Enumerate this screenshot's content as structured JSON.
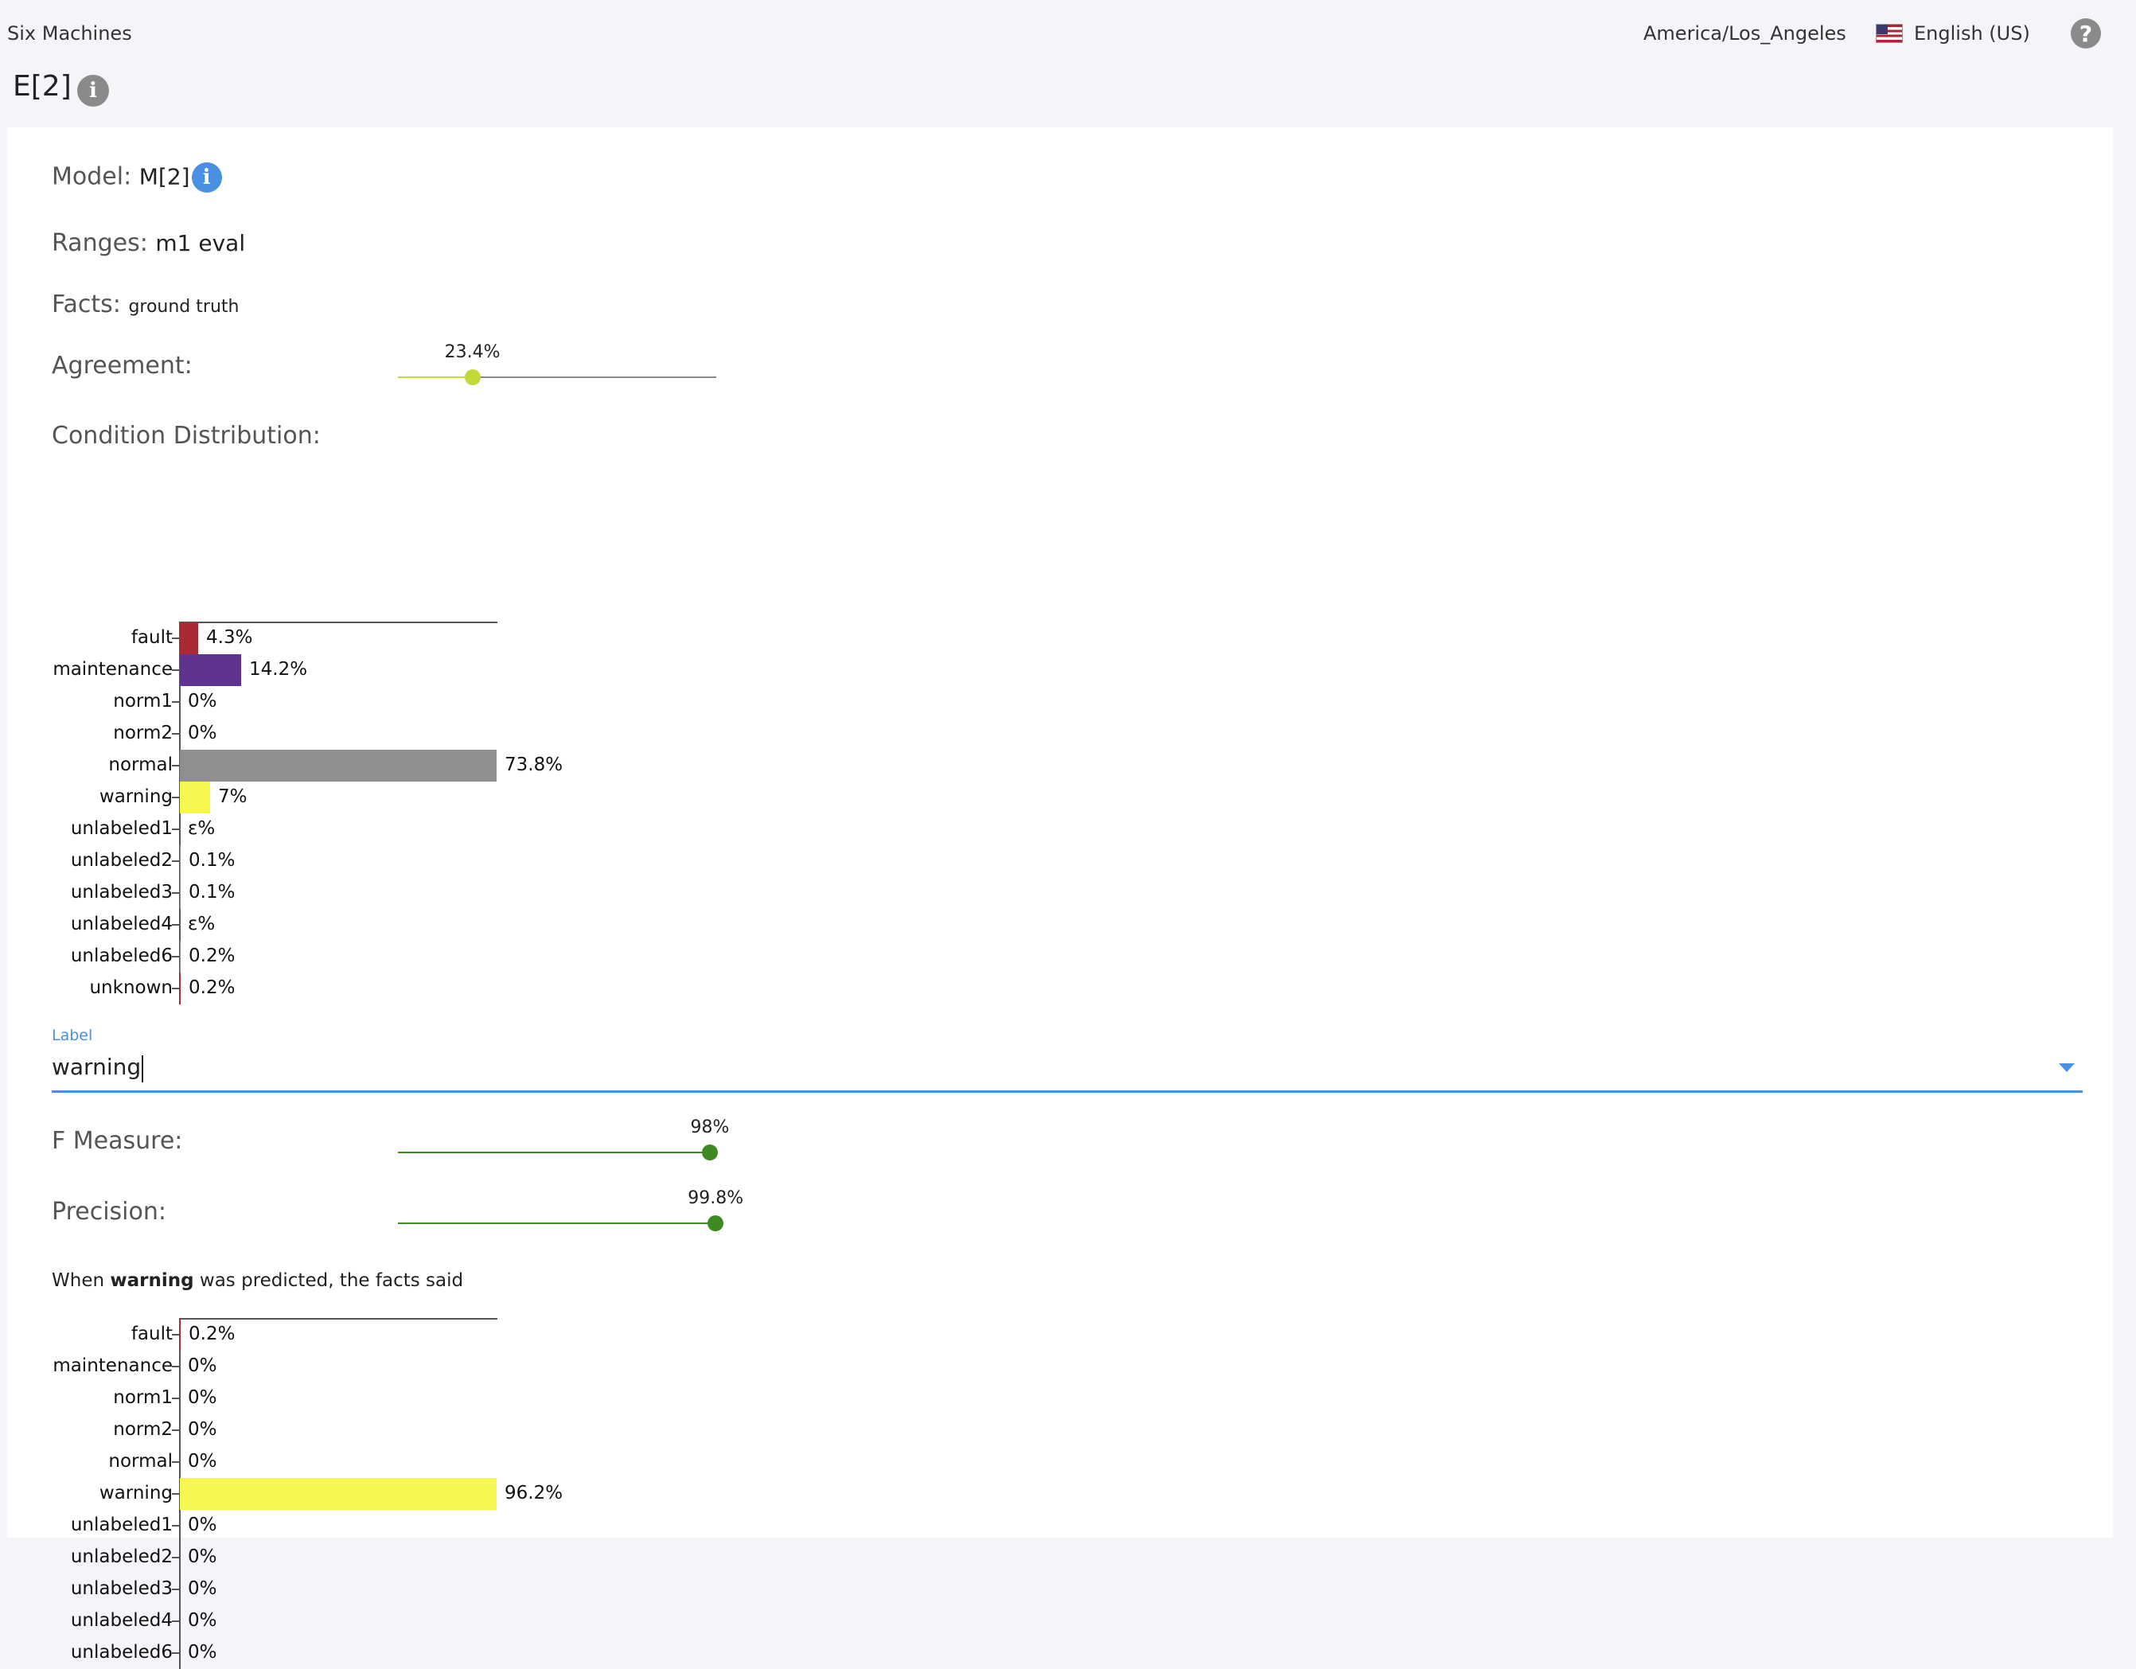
{
  "header": {
    "brand": "Six Machines",
    "timezone": "America/Los_Angeles",
    "language": "English (US)"
  },
  "page": {
    "title": "E[2]"
  },
  "details": {
    "model_label": "Model:",
    "model_value": "M[2]",
    "ranges_label": "Ranges:",
    "ranges_value": "m1 eval",
    "facts_label": "Facts:",
    "facts_value": "ground truth",
    "agreement_label": "Agreement:",
    "agreement_text": "23.4%",
    "agreement_value": 0.234,
    "distribution_label": "Condition Distribution:"
  },
  "label_select": {
    "caption": "Label",
    "value": "warning"
  },
  "metrics": {
    "f_measure_label": "F Measure:",
    "f_measure_text": "98%",
    "f_measure_value": 0.98,
    "precision_label": "Precision:",
    "precision_text": "99.8%",
    "precision_value": 0.998,
    "sentence_prefix": "When",
    "sentence_bold": "warning",
    "sentence_suffix": "was predicted, the facts said"
  },
  "colors": {
    "fault": "#a82a35",
    "maintenance": "#5e3490",
    "normal": "#8f8f8f",
    "warning": "#f7f752",
    "unknown": "#a82a35",
    "agreement": "#c3d93a",
    "metric": "#3d8a22"
  },
  "chart_data": [
    {
      "type": "bar",
      "orientation": "horizontal",
      "categories": [
        "fault",
        "maintenance",
        "norm1",
        "norm2",
        "normal",
        "warning",
        "unlabeled1",
        "unlabeled2",
        "unlabeled3",
        "unlabeled4",
        "unlabeled6",
        "unknown"
      ],
      "values": [
        4.3,
        14.2,
        0,
        0,
        73.8,
        7,
        0.01,
        0.1,
        0.1,
        0.01,
        0.2,
        0.2
      ],
      "value_labels": [
        "4.3%",
        "14.2%",
        "0%",
        "0%",
        "73.8%",
        "7%",
        "ε%",
        "0.1%",
        "0.1%",
        "ε%",
        "0.2%",
        "0.2%"
      ],
      "colors": [
        "#a82a35",
        "#5e3490",
        "#8f8f8f",
        "#8f8f8f",
        "#8f8f8f",
        "#f7f752",
        "#8f8f8f",
        "#8f8f8f",
        "#8f8f8f",
        "#8f8f8f",
        "#8f8f8f",
        "#a82a35"
      ]
    },
    {
      "type": "bar",
      "orientation": "horizontal",
      "categories": [
        "fault",
        "maintenance",
        "norm1",
        "norm2",
        "normal",
        "warning",
        "unlabeled1",
        "unlabeled2",
        "unlabeled3",
        "unlabeled4",
        "unlabeled6"
      ],
      "values": [
        0.2,
        0,
        0,
        0,
        0,
        96.2,
        0,
        0,
        0,
        0,
        0
      ],
      "value_labels": [
        "0.2%",
        "0%",
        "0%",
        "0%",
        "0%",
        "96.2%",
        "0%",
        "0%",
        "0%",
        "0%",
        "0%"
      ],
      "colors": [
        "#a82a35",
        "#5e3490",
        "#8f8f8f",
        "#8f8f8f",
        "#8f8f8f",
        "#f7f752",
        "#8f8f8f",
        "#8f8f8f",
        "#8f8f8f",
        "#8f8f8f",
        "#8f8f8f"
      ]
    }
  ]
}
